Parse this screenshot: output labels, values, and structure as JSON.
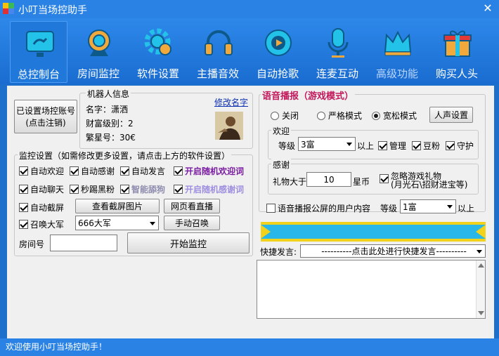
{
  "window": {
    "title": "小叮当场控助手",
    "close_glyph": "✕"
  },
  "toolbar": {
    "items": [
      {
        "label": "总控制台",
        "icon": "monitor-icon"
      },
      {
        "label": "房间监控",
        "icon": "webcam-icon"
      },
      {
        "label": "软件设置",
        "icon": "gear-icon"
      },
      {
        "label": "主播音效",
        "icon": "headphones-icon"
      },
      {
        "label": "自动抢歌",
        "icon": "music-disc-icon"
      },
      {
        "label": "连麦互动",
        "icon": "microphone-icon"
      },
      {
        "label": "高级功能",
        "icon": "crown-icon"
      },
      {
        "label": "购买人头",
        "icon": "gift-icon"
      }
    ]
  },
  "account": {
    "button_line1": "已设置场控账号",
    "button_line2": "(点击注销)"
  },
  "robot": {
    "group_title": "机器人信息",
    "name_label": "名字：潇洒",
    "wealth_label": "财富级别：2",
    "star_label": "繁星号：30€",
    "edit_name": "修改名字"
  },
  "monitor": {
    "group_title": "监控设置（如需修改更多设置，请点击上方的软件设置）",
    "options": {
      "auto_welcome": "自动欢迎",
      "auto_thanks": "自动感谢",
      "auto_speak": "自动发言",
      "random_welcome": "开启随机欢迎词",
      "auto_chat": "自动聊天",
      "kick_black": "秒踢黑粉",
      "smart_mute": "智能舔狗",
      "random_thanks": "开启随机感谢词",
      "auto_screenshot": "自动截屏",
      "summon": "召唤大军"
    },
    "view_screenshot": "查看截屏图片",
    "web_live": "网页看直播",
    "summon_select": "666大军",
    "manual_summon": "手动召唤",
    "room_label": "房间号",
    "room_value": "",
    "start": "开始监控"
  },
  "voice": {
    "title": "语音播报（游戏模式）",
    "modes": [
      "关闭",
      "严格模式",
      "宽松模式"
    ],
    "voice_settings": "人声设置",
    "welcome": {
      "group_title": "欢迎",
      "level_label": "等级",
      "level_value": "3富",
      "above": "以上",
      "opt_admin": "管理",
      "opt_fans": "豆粉",
      "opt_guard": "守护"
    },
    "thanks": {
      "group_title": "感谢",
      "gift_label": "礼物大于",
      "gift_value": "10",
      "unit": "星币",
      "ignore_line1": "忽略游戏礼物",
      "ignore_line2": "(月光石\\招财进宝等)"
    },
    "public_screen": {
      "label": "语音播报公屏的用户内容",
      "level_label": "等级",
      "level_value": "1富",
      "above": "以上"
    }
  },
  "quick": {
    "label": "快捷发言:",
    "placeholder": "----------点击此处进行快捷发言----------",
    "log_value": ""
  },
  "status": {
    "text": "欢迎使用小叮当场控助手！"
  },
  "colors": {
    "accent_blue": "#2a82e4",
    "banner_cyan": "#29b6e8",
    "banner_yellow": "#f2d21b"
  }
}
